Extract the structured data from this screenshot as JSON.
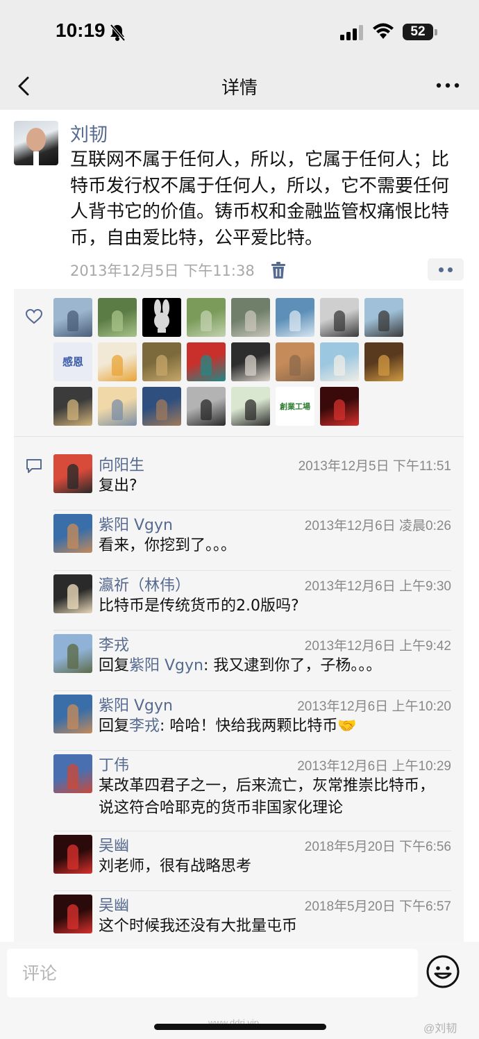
{
  "status_bar": {
    "time": "10:19",
    "battery": "52"
  },
  "nav": {
    "title": "详情"
  },
  "post": {
    "author": "刘韧",
    "text": "互联网不属于任何人，所以，它属于任何人；比特币发行权不属于任何人，所以，它不需要任何人背书它的价值。铸币权和金融监管权痛恨比特币，自由爱比特，公平爱比特。",
    "time": "2013年12月5日 下午11:38"
  },
  "likes": {
    "count_shown": 23,
    "tiles": [
      {
        "kind": "photo",
        "colors": [
          "#9cb6cf",
          "#4a5e78"
        ]
      },
      {
        "kind": "photo",
        "colors": [
          "#5b7d45",
          "#a8c38a"
        ]
      },
      {
        "kind": "bunny",
        "colors": [
          "#000000",
          "#d0d0d0"
        ]
      },
      {
        "kind": "photo",
        "colors": [
          "#7a9b5a",
          "#c3d2b0"
        ]
      },
      {
        "kind": "photo",
        "colors": [
          "#6f7f6a",
          "#c9c6b8"
        ]
      },
      {
        "kind": "photo",
        "colors": [
          "#5d8fb8",
          "#d8e6f0"
        ]
      },
      {
        "kind": "photo",
        "colors": [
          "#cfcfcf",
          "#3b3b3b"
        ]
      },
      {
        "kind": "photo",
        "colors": [
          "#9fc0d8",
          "#3a3a3a"
        ]
      },
      {
        "kind": "text",
        "label": "感恩",
        "colors": [
          "#e9ecf5",
          "#3b5aa8"
        ]
      },
      {
        "kind": "photo",
        "colors": [
          "#f1e9d6",
          "#e9a437"
        ]
      },
      {
        "kind": "photo",
        "colors": [
          "#7c6a3c",
          "#c7a76a"
        ]
      },
      {
        "kind": "photo",
        "colors": [
          "#c9302c",
          "#1f8a87"
        ]
      },
      {
        "kind": "photo",
        "colors": [
          "#2d2d2d",
          "#d8d2c8"
        ]
      },
      {
        "kind": "photo",
        "colors": [
          "#c58b59",
          "#8c6a4c"
        ]
      },
      {
        "kind": "photo",
        "colors": [
          "#9cc7e0",
          "#f0ede6"
        ]
      },
      {
        "kind": "photo",
        "colors": [
          "#5a3a1e",
          "#d19a42"
        ]
      },
      {
        "kind": "photo",
        "colors": [
          "#3b3b3b",
          "#d2b37a"
        ]
      },
      {
        "kind": "photo",
        "colors": [
          "#f0d8a8",
          "#7b8fa5"
        ]
      },
      {
        "kind": "photo",
        "colors": [
          "#2f4f7f",
          "#a07a5a"
        ]
      },
      {
        "kind": "photo",
        "colors": [
          "#b3b3b3",
          "#2a2a2a"
        ]
      },
      {
        "kind": "photo",
        "colors": [
          "#d9e6d0",
          "#2e2e2e"
        ]
      },
      {
        "kind": "text",
        "label": "創業工場",
        "colors": [
          "#ffffff",
          "#2e7d32"
        ]
      },
      {
        "kind": "photo",
        "colors": [
          "#3a0a0a",
          "#d6302c"
        ]
      }
    ]
  },
  "comments": [
    {
      "name": "向阳生",
      "time": "2013年12月5日 下午11:51",
      "text": "复出?",
      "colors": [
        "#d84a3a",
        "#2a2a2a"
      ]
    },
    {
      "name": "紫阳 Vgyn",
      "time": "2013年12月6日 凌晨0:26",
      "text": "看来，你挖到了。。。",
      "colors": [
        "#3a6ea8",
        "#c38a5a"
      ]
    },
    {
      "name": "瀛祈（林伟）",
      "time": "2013年12月6日 上午9:30",
      "text": "比特币是传统货币的2.0版吗?",
      "colors": [
        "#2a2a2a",
        "#e8d8b8"
      ]
    },
    {
      "name": "李戎",
      "time": "2013年12月6日 上午9:42",
      "reply_prefix": "回复",
      "reply_to": "紫阳 Vgyn",
      "text": ": 我又逮到你了，子杨。。。",
      "colors": [
        "#8fb2d6",
        "#5d6b4a"
      ]
    },
    {
      "name": "紫阳 Vgyn",
      "time": "2013年12月6日 上午10:20",
      "reply_prefix": "回复",
      "reply_to": "李戎",
      "text": ": 哈哈！快给我两颗比特币🤝",
      "colors": [
        "#3a6ea8",
        "#c38a5a"
      ]
    },
    {
      "name": "丁伟",
      "time": "2013年12月6日 上午10:29",
      "text": "某改革四君子之一，后来流亡，灰常推崇比特币，说这符合哈耶克的货币非国家化理论",
      "colors": [
        "#4a6fb0",
        "#c94a3a"
      ]
    },
    {
      "name": "吴幽",
      "time": "2018年5月20日 下午6:56",
      "text": "刘老师，很有战略思考",
      "colors": [
        "#2a0a0a",
        "#d6302c"
      ]
    },
    {
      "name": "吴幽",
      "time": "2018年5月20日 下午6:57",
      "text": "这个时候我还没有大批量屯币",
      "colors": [
        "#2a0a0a",
        "#d6302c"
      ]
    }
  ],
  "input": {
    "placeholder": "评论"
  },
  "watermark": "www.ddrj.vip",
  "weibo_watermark": "@刘韧"
}
